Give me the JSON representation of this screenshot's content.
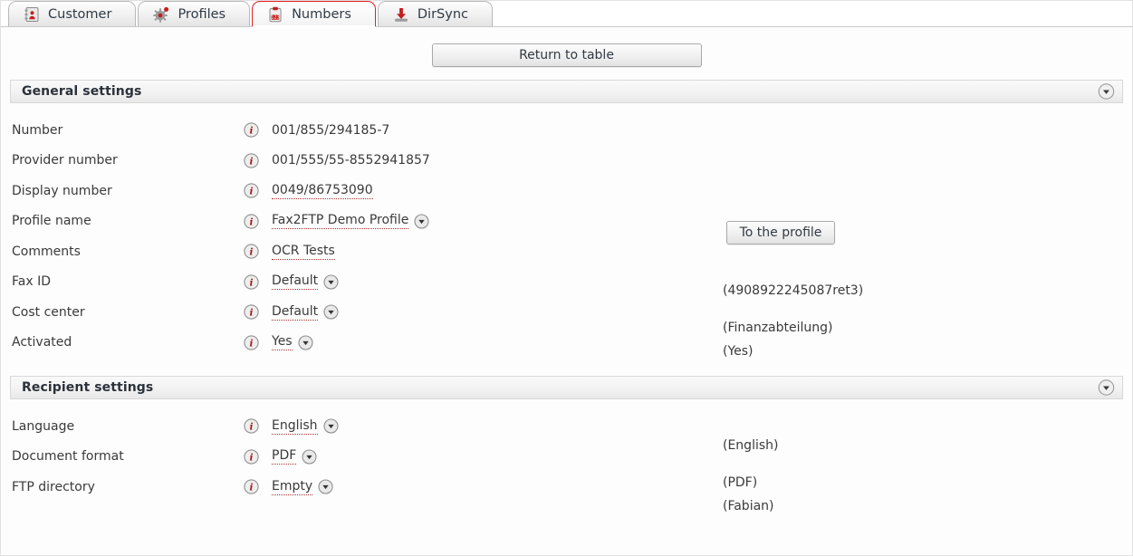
{
  "tabs": [
    {
      "id": "customer",
      "label": "Customer",
      "icon": "address-book-icon",
      "active": false
    },
    {
      "id": "profiles",
      "label": "Profiles",
      "icon": "gear-icon",
      "active": false
    },
    {
      "id": "numbers",
      "label": "Numbers",
      "icon": "clipboard-123-icon",
      "active": true
    },
    {
      "id": "dirsync",
      "label": "DirSync",
      "icon": "download-tray-icon",
      "active": false
    }
  ],
  "toolbar": {
    "return_to_table_label": "Return to table"
  },
  "sections": [
    {
      "id": "general-settings",
      "title": "General settings",
      "collapse_icon": "chevron-down-circle-icon",
      "rows": [
        {
          "label": "Number",
          "info_icon": "info-icon",
          "value": "001/855/294185-7",
          "editable": false,
          "dropdown": false
        },
        {
          "label": "Provider number",
          "info_icon": "info-icon",
          "value": "001/555/55-8552941857",
          "editable": false,
          "dropdown": false
        },
        {
          "label": "Display number",
          "info_icon": "info-icon",
          "value": "0049/86753090",
          "editable": true,
          "dropdown": false
        },
        {
          "label": "Profile name",
          "info_icon": "info-icon",
          "value": "Fax2FTP Demo Profile",
          "editable": true,
          "dropdown": true
        },
        {
          "label": "Comments",
          "info_icon": "info-icon",
          "value": "OCR Tests",
          "editable": true,
          "dropdown": false
        },
        {
          "label": "Fax ID",
          "info_icon": "info-icon",
          "value": "Default",
          "editable": true,
          "dropdown": true
        },
        {
          "label": "Cost center",
          "info_icon": "info-icon",
          "value": "Default",
          "editable": true,
          "dropdown": true
        },
        {
          "label": "Activated",
          "info_icon": "info-icon",
          "value": "Yes",
          "editable": true,
          "dropdown": true
        }
      ],
      "side": {
        "profile_button_label": "To the profile",
        "fax_id_inherited": "(4908922245087ret3)",
        "cost_center_inherited": "(Finanzabteilung)",
        "activated_inherited": "(Yes)"
      }
    },
    {
      "id": "recipient-settings",
      "title": "Recipient settings",
      "collapse_icon": "chevron-down-circle-icon",
      "rows": [
        {
          "label": "Language",
          "info_icon": "info-icon",
          "value": "English",
          "editable": true,
          "dropdown": true
        },
        {
          "label": "Document format",
          "info_icon": "info-icon",
          "value": "PDF",
          "editable": true,
          "dropdown": true
        },
        {
          "label": "FTP directory",
          "info_icon": "info-icon",
          "value": "Empty",
          "editable": true,
          "dropdown": true
        }
      ],
      "side": {
        "language_inherited": "(English)",
        "document_format_inherited": "(PDF)",
        "ftp_directory_inherited": "(Fabian)"
      }
    }
  ],
  "colors": {
    "accent_red": "#cc2222",
    "tab_active_border": "#e02020",
    "dotted_underline": "#a83030",
    "text": "#3a3a3a",
    "section_header_bg": "#f2f2f2"
  }
}
